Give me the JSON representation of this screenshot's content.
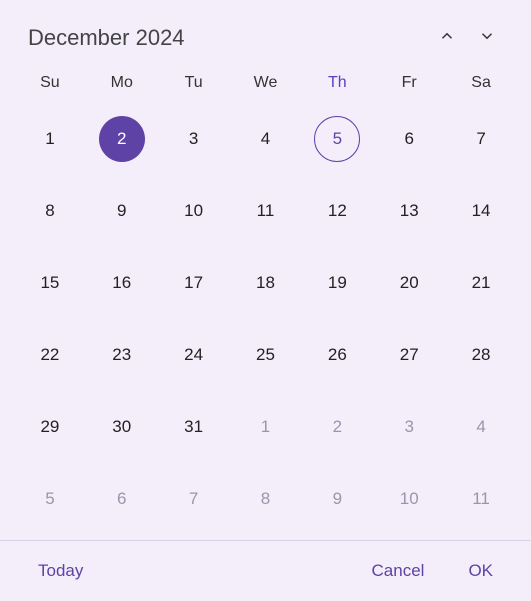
{
  "header": {
    "title": "December 2024"
  },
  "dow": [
    "Su",
    "Mo",
    "Tu",
    "We",
    "Th",
    "Fr",
    "Sa"
  ],
  "todayCol": 4,
  "days": [
    {
      "n": 1,
      "out": false,
      "selected": false,
      "today": false
    },
    {
      "n": 2,
      "out": false,
      "selected": true,
      "today": false
    },
    {
      "n": 3,
      "out": false,
      "selected": false,
      "today": false
    },
    {
      "n": 4,
      "out": false,
      "selected": false,
      "today": false
    },
    {
      "n": 5,
      "out": false,
      "selected": false,
      "today": true
    },
    {
      "n": 6,
      "out": false,
      "selected": false,
      "today": false
    },
    {
      "n": 7,
      "out": false,
      "selected": false,
      "today": false
    },
    {
      "n": 8,
      "out": false,
      "selected": false,
      "today": false
    },
    {
      "n": 9,
      "out": false,
      "selected": false,
      "today": false
    },
    {
      "n": 10,
      "out": false,
      "selected": false,
      "today": false
    },
    {
      "n": 11,
      "out": false,
      "selected": false,
      "today": false
    },
    {
      "n": 12,
      "out": false,
      "selected": false,
      "today": false
    },
    {
      "n": 13,
      "out": false,
      "selected": false,
      "today": false
    },
    {
      "n": 14,
      "out": false,
      "selected": false,
      "today": false
    },
    {
      "n": 15,
      "out": false,
      "selected": false,
      "today": false
    },
    {
      "n": 16,
      "out": false,
      "selected": false,
      "today": false
    },
    {
      "n": 17,
      "out": false,
      "selected": false,
      "today": false
    },
    {
      "n": 18,
      "out": false,
      "selected": false,
      "today": false
    },
    {
      "n": 19,
      "out": false,
      "selected": false,
      "today": false
    },
    {
      "n": 20,
      "out": false,
      "selected": false,
      "today": false
    },
    {
      "n": 21,
      "out": false,
      "selected": false,
      "today": false
    },
    {
      "n": 22,
      "out": false,
      "selected": false,
      "today": false
    },
    {
      "n": 23,
      "out": false,
      "selected": false,
      "today": false
    },
    {
      "n": 24,
      "out": false,
      "selected": false,
      "today": false
    },
    {
      "n": 25,
      "out": false,
      "selected": false,
      "today": false
    },
    {
      "n": 26,
      "out": false,
      "selected": false,
      "today": false
    },
    {
      "n": 27,
      "out": false,
      "selected": false,
      "today": false
    },
    {
      "n": 28,
      "out": false,
      "selected": false,
      "today": false
    },
    {
      "n": 29,
      "out": false,
      "selected": false,
      "today": false
    },
    {
      "n": 30,
      "out": false,
      "selected": false,
      "today": false
    },
    {
      "n": 31,
      "out": false,
      "selected": false,
      "today": false
    },
    {
      "n": 1,
      "out": true,
      "selected": false,
      "today": false
    },
    {
      "n": 2,
      "out": true,
      "selected": false,
      "today": false
    },
    {
      "n": 3,
      "out": true,
      "selected": false,
      "today": false
    },
    {
      "n": 4,
      "out": true,
      "selected": false,
      "today": false
    },
    {
      "n": 5,
      "out": true,
      "selected": false,
      "today": false
    },
    {
      "n": 6,
      "out": true,
      "selected": false,
      "today": false
    },
    {
      "n": 7,
      "out": true,
      "selected": false,
      "today": false
    },
    {
      "n": 8,
      "out": true,
      "selected": false,
      "today": false
    },
    {
      "n": 9,
      "out": true,
      "selected": false,
      "today": false
    },
    {
      "n": 10,
      "out": true,
      "selected": false,
      "today": false
    },
    {
      "n": 11,
      "out": true,
      "selected": false,
      "today": false
    }
  ],
  "footer": {
    "today": "Today",
    "cancel": "Cancel",
    "ok": "OK"
  }
}
